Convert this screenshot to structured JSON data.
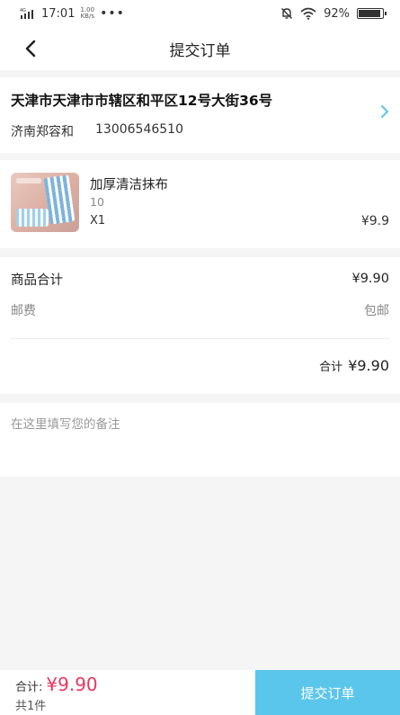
{
  "status_bar": {
    "network": "4G",
    "time": "17:01",
    "speed_value": "1.00",
    "speed_unit": "KB/s",
    "battery": "92%",
    "battery_level": 0.92
  },
  "header": {
    "title": "提交订单"
  },
  "address": {
    "line": "天津市天津市市辖区和平区12号大街36号",
    "name": "济南郑容和",
    "phone": "13006546510"
  },
  "product": {
    "name": "加厚清洁抹布",
    "spec": "10",
    "quantity": "X1",
    "price": "¥9.9"
  },
  "summary": {
    "goods_label": "商品合计",
    "goods_value": "¥9.90",
    "shipping_label": "邮费",
    "shipping_value": "包邮",
    "total_label": "合计",
    "total_value": "¥9.90"
  },
  "remark": {
    "placeholder": "在这里填写您的备注"
  },
  "bottom_bar": {
    "total_label": "合计:",
    "total_value": "¥9.90",
    "count": "共1件",
    "submit_label": "提交订单"
  },
  "colors": {
    "accent": "#5bc6ec",
    "price_red": "#e8365f"
  }
}
